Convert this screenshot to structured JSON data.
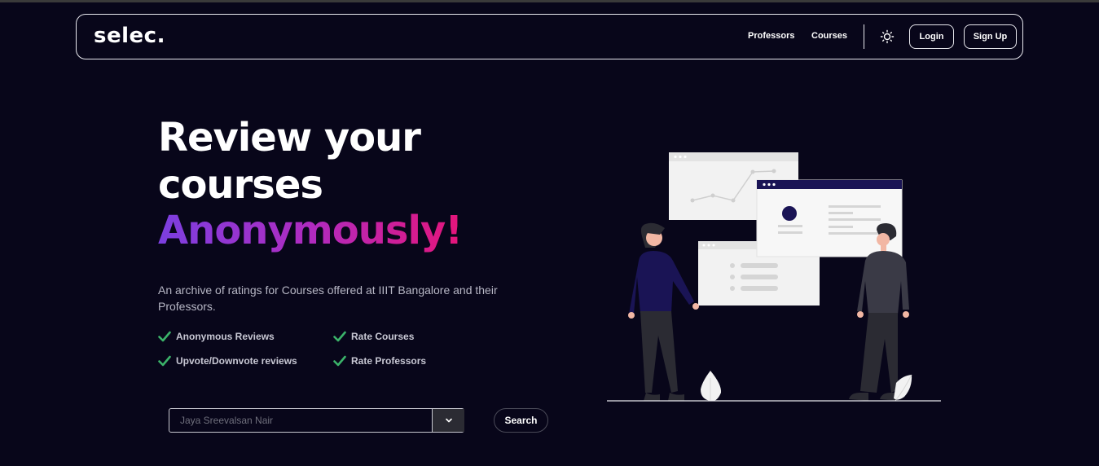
{
  "nav": {
    "logo": "selec.",
    "links": [
      "Professors",
      "Courses"
    ],
    "login_label": "Login",
    "signup_label": "Sign Up",
    "theme_icon": "sun-icon"
  },
  "hero": {
    "title": "Review your courses",
    "accent": "Anonymously!",
    "description": "An archive of ratings for Courses offered at IIIT Bangalore and their Professors.",
    "features": [
      "Anonymous Reviews",
      "Rate Courses",
      "Upvote/Downvote reviews",
      "Rate Professors"
    ]
  },
  "search": {
    "placeholder": "Jaya Sreevalsan Nair",
    "button_label": "Search"
  },
  "colors": {
    "background": "#08061a",
    "accent_start": "#7b3fe0",
    "accent_end": "#e5157a",
    "check": "#3bb36a"
  }
}
